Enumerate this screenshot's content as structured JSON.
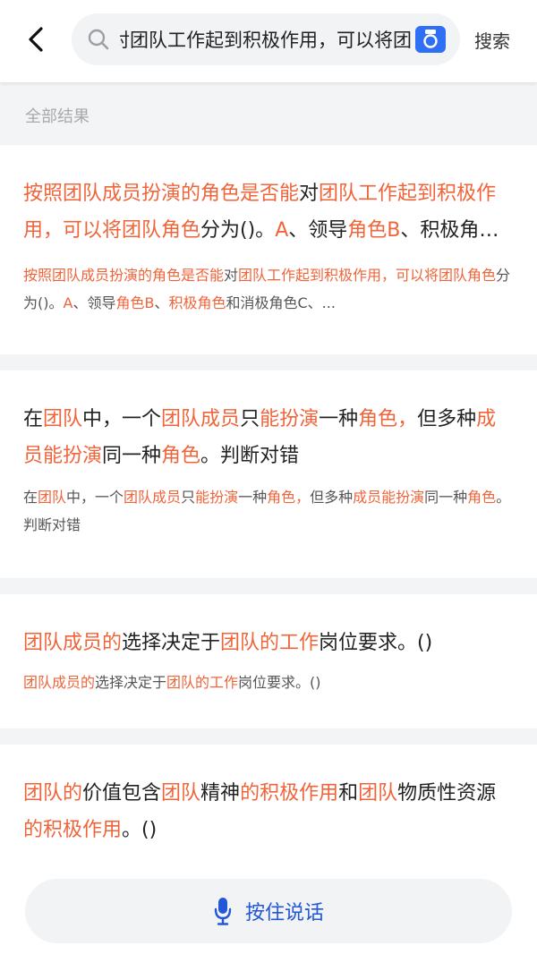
{
  "header": {
    "query": "按照团队成员扮演的角色是否能对团队工作起到积极作用，可以将团",
    "search_label": "搜索",
    "icons": {
      "back": "back-arrow-icon",
      "search": "search-icon",
      "camera": "camera-icon"
    },
    "accent_color": "#2f6ff5"
  },
  "results_label": "全部结果",
  "highlight_color": "#f0643a",
  "cards": [
    {
      "title": [
        {
          "t": "按照团队成员扮演的角色是否能",
          "hl": true
        },
        {
          "t": "对",
          "hl": false
        },
        {
          "t": "团队工作起到积极作用，可以将团队角色",
          "hl": true
        },
        {
          "t": "分为()。",
          "hl": false
        },
        {
          "t": "A",
          "hl": true
        },
        {
          "t": "、领导",
          "hl": false
        },
        {
          "t": "角色B",
          "hl": true
        },
        {
          "t": "、积极角色和消极角色C、…",
          "hl": false
        }
      ],
      "snippet": [
        {
          "t": "按照团队成员扮演的角色是否能",
          "hl": true
        },
        {
          "t": "对",
          "hl": false
        },
        {
          "t": "团队工作起到积极作用，可以将团队角色",
          "hl": true
        },
        {
          "t": "分为()。",
          "hl": false
        },
        {
          "t": "A",
          "hl": true
        },
        {
          "t": "、领导",
          "hl": false
        },
        {
          "t": "角色B",
          "hl": true
        },
        {
          "t": "、",
          "hl": false
        },
        {
          "t": "积极角色",
          "hl": true
        },
        {
          "t": "和消极角色C、...",
          "hl": false
        }
      ]
    },
    {
      "title": [
        {
          "t": "在",
          "hl": false
        },
        {
          "t": "团队",
          "hl": true
        },
        {
          "t": "中，一个",
          "hl": false
        },
        {
          "t": "团队成员",
          "hl": true
        },
        {
          "t": "只",
          "hl": false
        },
        {
          "t": "能扮演",
          "hl": true
        },
        {
          "t": "一种",
          "hl": false
        },
        {
          "t": "角色，",
          "hl": true
        },
        {
          "t": "但多种",
          "hl": false
        },
        {
          "t": "成员能扮演",
          "hl": true
        },
        {
          "t": "同一种",
          "hl": false
        },
        {
          "t": "角色",
          "hl": true
        },
        {
          "t": "。判断对错",
          "hl": false
        }
      ],
      "snippet": [
        {
          "t": "在",
          "hl": false
        },
        {
          "t": "团队",
          "hl": true
        },
        {
          "t": "中，一个",
          "hl": false
        },
        {
          "t": "团队成员",
          "hl": true
        },
        {
          "t": "只",
          "hl": false
        },
        {
          "t": "能扮演",
          "hl": true
        },
        {
          "t": "一种",
          "hl": false
        },
        {
          "t": "角色，",
          "hl": true
        },
        {
          "t": "但多种",
          "hl": false
        },
        {
          "t": "成员能扮演",
          "hl": true
        },
        {
          "t": "同一种",
          "hl": false
        },
        {
          "t": "角色",
          "hl": true
        },
        {
          "t": "。判断对错",
          "hl": false
        }
      ]
    },
    {
      "title": [
        {
          "t": "团队成员的",
          "hl": true
        },
        {
          "t": "选择决定于",
          "hl": false
        },
        {
          "t": "团队的工作",
          "hl": true
        },
        {
          "t": "岗位要求。()",
          "hl": false
        }
      ],
      "snippet": [
        {
          "t": "团队成员的",
          "hl": true
        },
        {
          "t": "选择决定于",
          "hl": false
        },
        {
          "t": "团队的工作",
          "hl": true
        },
        {
          "t": "岗位要求。()",
          "hl": false
        }
      ]
    },
    {
      "title": [
        {
          "t": "团队的",
          "hl": true
        },
        {
          "t": "价值包含",
          "hl": false
        },
        {
          "t": "团队",
          "hl": true
        },
        {
          "t": "精神",
          "hl": false
        },
        {
          "t": "的积极作用",
          "hl": true
        },
        {
          "t": "和",
          "hl": false
        },
        {
          "t": "团队",
          "hl": true
        },
        {
          "t": "物质性资源",
          "hl": false
        },
        {
          "t": "的积极作用",
          "hl": true
        },
        {
          "t": "。()",
          "hl": false
        }
      ],
      "snippet": []
    }
  ],
  "voice": {
    "label": "按住说话",
    "icon": "microphone-icon"
  }
}
